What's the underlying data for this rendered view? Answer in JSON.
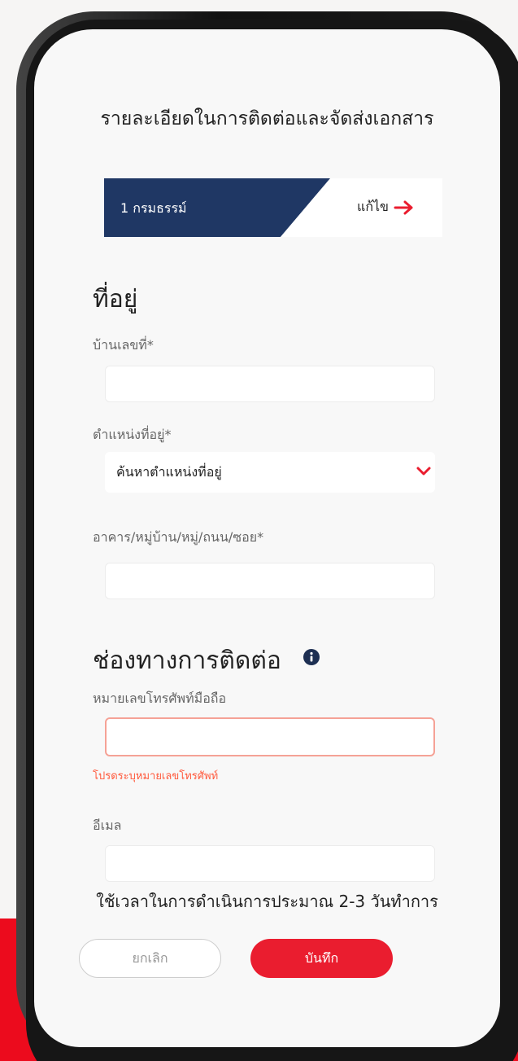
{
  "header": {
    "title": "รายละเอียดในการติดต่อและจัดส่งเอกสาร"
  },
  "tabs": {
    "active_label": "1 กรมธรรม์",
    "edit_label": "แก้ไข"
  },
  "address": {
    "section_title": "ที่อยู่",
    "house_number_label": "บ้านเลขที่*",
    "location_label": "ตำแหน่งที่อยู่*",
    "location_value": "ค้นหาตำแหน่งที่อยู่",
    "street_label": "อาคาร/หมู่บ้าน/หมู่/ถนน/ซอย*"
  },
  "contact": {
    "section_title": "ช่องทางการติดต่อ",
    "mobile_label": "หมายเลขโทรศัพท์มือถือ",
    "mobile_error": "โปรดระบุหมายเลขโทรศัพท์",
    "email_label": "อีเมล"
  },
  "footer": {
    "processing_note": "ใช้เวลาในการดำเนินการประมาณ 2-3 วันทำการ",
    "cancel_label": "ยกเลิก",
    "save_label": "บันทึก"
  },
  "colors": {
    "primary_navy": "#1f3764",
    "accent_red": "#ea1d2f",
    "error": "#ff5a3d"
  }
}
